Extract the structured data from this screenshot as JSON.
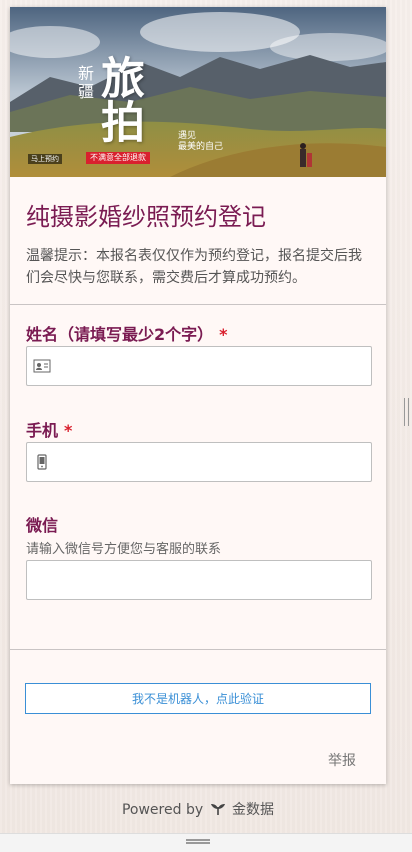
{
  "banner": {
    "brand_small": "新疆",
    "brand_large": "旅拍",
    "meet_line1": "遇见",
    "meet_line2": "最美的自己",
    "red_tag": "不满意全部退款",
    "dark_tag": "马上预约"
  },
  "form": {
    "title": "纯摄影婚纱照预约登记",
    "tip": "温馨提示：本报名表仅仅作为预约登记，报名提交后我们会尽快与您联系，需交费后才算成功预约。",
    "fields": [
      {
        "label": "姓名（请填写最少2个字）",
        "required_mark": "*",
        "value": "",
        "placeholder": "",
        "icon": "id-card-icon"
      },
      {
        "label": "手机",
        "required_mark": "*",
        "value": "",
        "placeholder": "",
        "icon": "phone-icon"
      },
      {
        "label": "微信",
        "description": "请输入微信号方便您与客服的联系",
        "value": "",
        "placeholder": ""
      }
    ],
    "captcha_label": "我不是机器人，点此验证",
    "report_label": "举报"
  },
  "footer": {
    "powered_by": "Powered by",
    "brand": "金数据"
  },
  "colors": {
    "title": "#7a1b52",
    "required": "#d9202e",
    "captcha_border": "#3a8fd6"
  }
}
